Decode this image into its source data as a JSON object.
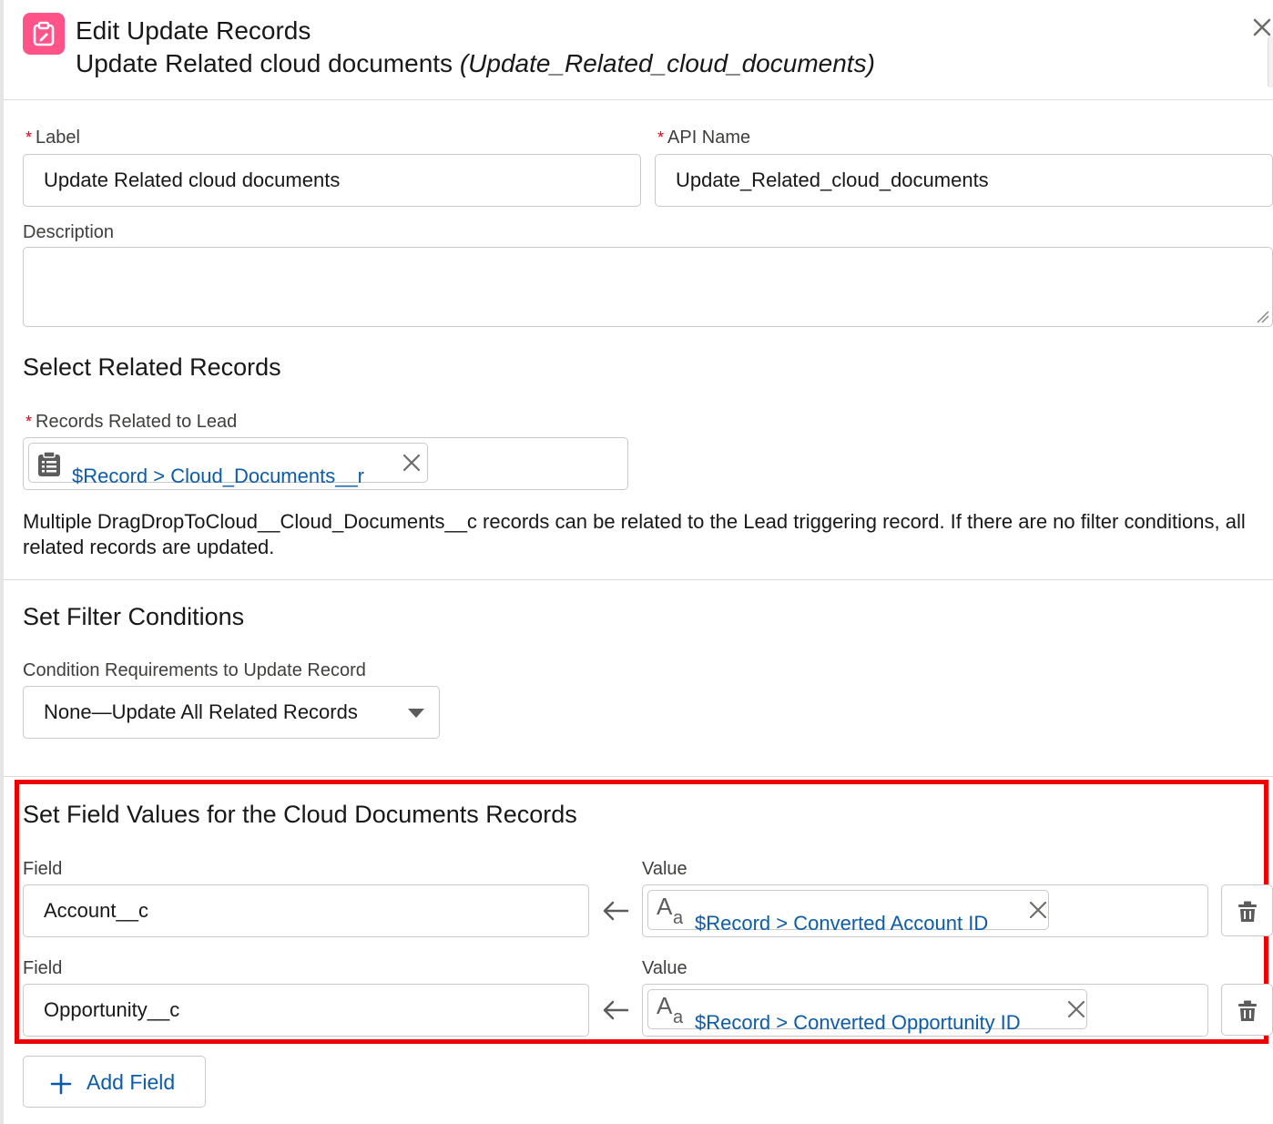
{
  "header": {
    "title": "Edit Update Records",
    "subtitle_label": "Update Related cloud documents",
    "subtitle_api": "(Update_Related_cloud_documents)",
    "icon": "update-records-icon",
    "icon_color": "#ff538a"
  },
  "form": {
    "label_field": {
      "label": "Label",
      "value": "Update Related cloud documents",
      "required": true
    },
    "api_name_field": {
      "label": "API Name",
      "value": "Update_Related_cloud_documents",
      "required": true
    },
    "description_field": {
      "label": "Description",
      "value": ""
    }
  },
  "select_related": {
    "title": "Select Related Records",
    "records_label": "Records Related to Lead",
    "records_value": "$Record > Cloud_Documents__r",
    "help_text": "Multiple DragDropToCloud__Cloud_Documents__c records can be related to the Lead triggering record. If there are no filter conditions, all related records are updated."
  },
  "filter": {
    "title": "Set Filter Conditions",
    "condition_label": "Condition Requirements to Update Record",
    "condition_value": "None—Update All Related Records"
  },
  "field_values": {
    "title": "Set Field Values for the Cloud Documents Records",
    "rows": [
      {
        "field_label": "Field",
        "field_value": "Account__c",
        "value_label": "Value",
        "value_pill": "$Record > Converted Account ID"
      },
      {
        "field_label": "Field",
        "field_value": "Opportunity__c",
        "value_label": "Value",
        "value_pill": "$Record > Converted Opportunity ID"
      }
    ],
    "add_button": "Add Field",
    "highlight_color": "#ee0000"
  },
  "colors": {
    "link": "#0b5cab",
    "required": "#ea001e",
    "border": "#c9c9c9"
  }
}
